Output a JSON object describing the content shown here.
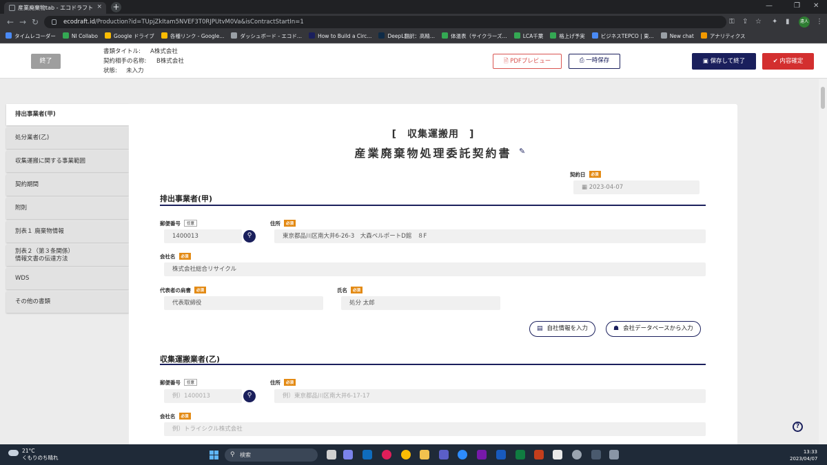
{
  "browser": {
    "tab_title": "産業廃棄物tab - エコドラフト",
    "tab_close": "×",
    "new_tab": "+",
    "url_host": "ecodraft.id",
    "url_path": "/Production?id=TUpjZkItam5NVEF3T0RJPUtvM0Va&isContractStartIn=1",
    "profile_label": "遠人",
    "bookmarks": [
      {
        "label": "タイムレコーダー",
        "color": "#4a8af4"
      },
      {
        "label": "NI Collabo",
        "color": "#34a853"
      },
      {
        "label": "Google ドライブ",
        "color": "#fbbc04"
      },
      {
        "label": "各種リンク - Google...",
        "color": "#fbbc04"
      },
      {
        "label": "ダッシュボード - エコド...",
        "color": "#9aa0a6"
      },
      {
        "label": "How to Build a Circ...",
        "color": "#1a1f5c"
      },
      {
        "label": "DeepL翻訳：高精...",
        "color": "#0f2b46"
      },
      {
        "label": "体温表（サイクラーズ...",
        "color": "#34a853"
      },
      {
        "label": "LCA千葉",
        "color": "#34a853"
      },
      {
        "label": "格上げ予実",
        "color": "#34a853"
      },
      {
        "label": "ビジネスTEPCO | 東...",
        "color": "#4a8af4"
      },
      {
        "label": "New chat",
        "color": "#9aa0a6"
      },
      {
        "label": "アナリティクス",
        "color": "#f29900"
      }
    ]
  },
  "header": {
    "end_button": "終了",
    "doc_title_label": "書類タイトル:",
    "doc_title_value": "A株式会社",
    "partner_label": "契約相手の名称:",
    "partner_value": "B株式会社",
    "status_label": "状態:",
    "status_value": "未入力",
    "pdf_preview": "PDFプレビュー",
    "temp_save": "一時保存",
    "save_and_end": "保存して終了",
    "confirm": "内容確定"
  },
  "sidebar": {
    "items": [
      {
        "label": "排出事業者(甲)"
      },
      {
        "label": "処分業者(乙)"
      },
      {
        "label": "収集運搬に関する事業範囲"
      },
      {
        "label": "契約期間"
      },
      {
        "label": "附則"
      },
      {
        "label": "別表１ 廃棄物情報"
      },
      {
        "label": "別表２（第３条関係）情報文書の伝達方法"
      },
      {
        "label": "WDS"
      },
      {
        "label": "その他の書類"
      }
    ]
  },
  "document": {
    "subtitle": "[　収集運搬用　]",
    "title": "産業廃棄物処理委託契約書",
    "contract_date_label": "契約日",
    "contract_date_value": "2023-04-07",
    "required": "必須",
    "optional": "任意",
    "section1": {
      "heading": "排出事業者(甲)",
      "postal_label": "郵便番号",
      "postal_value": "1400013",
      "address_label": "住所",
      "address_value": "東京都品川区南大井6-26-3　大森ベルポートD館　８F",
      "company_label": "会社名",
      "company_value": "株式会社総合リサイクル",
      "rep_title_label": "代表者の肩書",
      "rep_title_value": "代表取締役",
      "name_label": "氏名",
      "name_value": "処分 太郎",
      "own_info_button": "自社情報を入力",
      "db_button": "会社データベースから入力"
    },
    "section2": {
      "heading": "収集運搬業者(乙)",
      "postal_label": "郵便番号",
      "postal_placeholder": "例）1400013",
      "address_label": "住所",
      "address_placeholder": "例）東京都品川区南大井6-17-17",
      "company_label": "会社名",
      "company_placeholder": "例）トライシクル株式会社"
    }
  },
  "help": "?",
  "taskbar": {
    "temp": "21°C",
    "weather": "くもりのち晴れ",
    "search": "検索",
    "time": "13:33",
    "date": "2023/04/07"
  }
}
